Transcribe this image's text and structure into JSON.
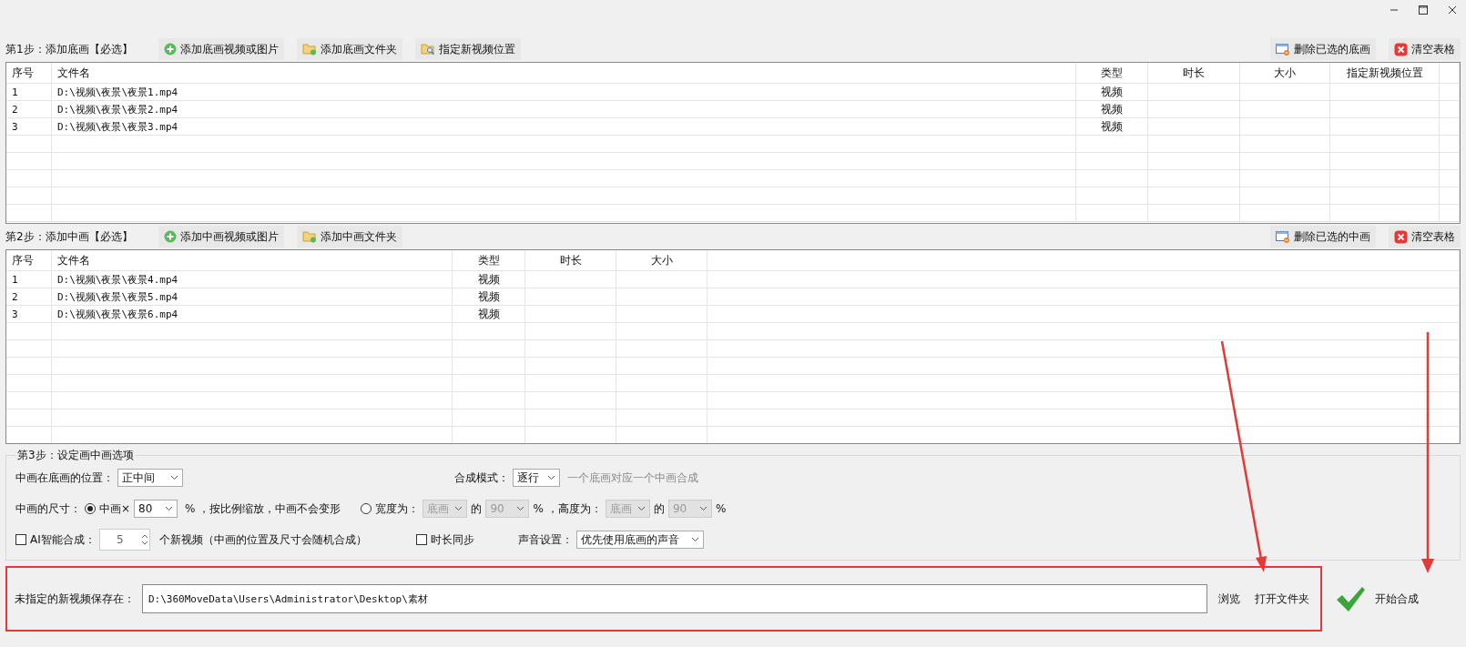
{
  "step1": {
    "title": "第1步：添加底画【必选】",
    "tools": [
      {
        "kind": "add",
        "label": "添加底画视频或图片"
      },
      {
        "kind": "folder",
        "label": "添加底画文件夹"
      },
      {
        "kind": "locate",
        "label": "指定新视频位置"
      }
    ],
    "actions": [
      {
        "kind": "delete",
        "label": "删除已选的底画"
      },
      {
        "kind": "clear",
        "label": "清空表格"
      }
    ],
    "table": {
      "columns": [
        "序号",
        "文件名",
        "类型",
        "时长",
        "大小",
        "指定新视频位置"
      ],
      "rows": [
        [
          "1",
          "D:\\视频\\夜景\\夜景1.mp4",
          "视频"
        ],
        [
          "2",
          "D:\\视频\\夜景\\夜景2.mp4",
          "视频"
        ],
        [
          "3",
          "D:\\视频\\夜景\\夜景3.mp4",
          "视频"
        ]
      ]
    }
  },
  "step2": {
    "title": "第2步：添加中画【必选】",
    "tools": [
      {
        "kind": "add",
        "label": "添加中画视频或图片"
      },
      {
        "kind": "folder",
        "label": "添加中画文件夹"
      }
    ],
    "actions": [
      {
        "kind": "delete",
        "label": "删除已选的中画"
      },
      {
        "kind": "clear",
        "label": "清空表格"
      }
    ],
    "table": {
      "columns": [
        "序号",
        "文件名",
        "类型",
        "时长",
        "大小"
      ],
      "rows": [
        [
          "1",
          "D:\\视频\\夜景\\夜景4.mp4",
          "视频"
        ],
        [
          "2",
          "D:\\视频\\夜景\\夜景5.mp4",
          "视频"
        ],
        [
          "3",
          "D:\\视频\\夜景\\夜景6.mp4",
          "视频"
        ]
      ]
    }
  },
  "step3": {
    "title": "第3步：设定画中画选项",
    "position": {
      "label": "中画在底画的位置：",
      "value": "正中间"
    },
    "mode": {
      "label": "合成模式：",
      "value": "逐行",
      "hint": "一个底画对应一个中画合成"
    },
    "size_label": "中画的尺寸：",
    "scale": {
      "label": "中画×",
      "selected": true,
      "value": "80",
      "unit": "%",
      "note": "，按比例缩放，中画不会变形"
    },
    "custom": {
      "label": "宽度为：",
      "selected": false,
      "width_base": "底画",
      "of1": "的",
      "width_value": "90",
      "unit1": "%",
      "height_label": "，高度为：",
      "height_base": "底画",
      "of2": "的",
      "height_value": "90",
      "unit2": "%",
      "disabled": true
    },
    "ai": {
      "label": "AI智能合成：",
      "checked": false,
      "value": "5",
      "note": "个新视频（中画的位置及尺寸会随机合成）"
    },
    "sync": {
      "label": "时长同步",
      "checked": false
    },
    "sound": {
      "label": "声音设置：",
      "value": "优先使用底画的声音"
    }
  },
  "output": {
    "label": "未指定的新视频保存在：",
    "path": "D:\\360MoveData\\Users\\Administrator\\Desktop\\素材",
    "browse": "浏览",
    "open": "打开文件夹",
    "start": "开始合成"
  }
}
